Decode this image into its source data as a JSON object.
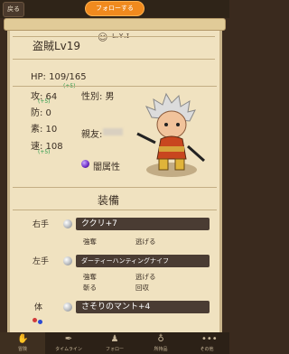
{
  "topbar": {
    "back_label": "戻る",
    "follow_label": "フォローする"
  },
  "character": {
    "name": "盗賊Lv19",
    "hp_label": "HP: 109/165",
    "hp_bonus": "(+5)",
    "stats": [
      {
        "label": "攻: 64",
        "bonus": "(+5)"
      },
      {
        "label": "防: 0",
        "bonus": ""
      },
      {
        "label": "素: 10",
        "bonus": ""
      },
      {
        "label": "速: 108",
        "bonus": "(+5)"
      }
    ],
    "gender": "性別: 男",
    "friend": "親友:",
    "attribute": "闇属性"
  },
  "equipment": {
    "title": "装備",
    "right": {
      "slot": "右手",
      "item": "ククリ+7",
      "effects": [
        "強奪",
        "逃げる"
      ]
    },
    "left": {
      "slot": "左手",
      "item": "ダーティーハンティングナイフ",
      "effects": [
        "強奪",
        "逃げる",
        "斬る",
        "回収"
      ]
    },
    "body": {
      "slot": "体",
      "item": "さそりのマント+4"
    }
  },
  "nav": {
    "items": [
      {
        "label": "冒険",
        "icon": "hand-icon"
      },
      {
        "label": "タイムライン",
        "icon": "quill-icon"
      },
      {
        "label": "フォロー",
        "icon": "people-icon"
      },
      {
        "label": "所持品",
        "icon": "bag-icon"
      },
      {
        "label": "その他",
        "icon": "more-icon"
      }
    ]
  }
}
